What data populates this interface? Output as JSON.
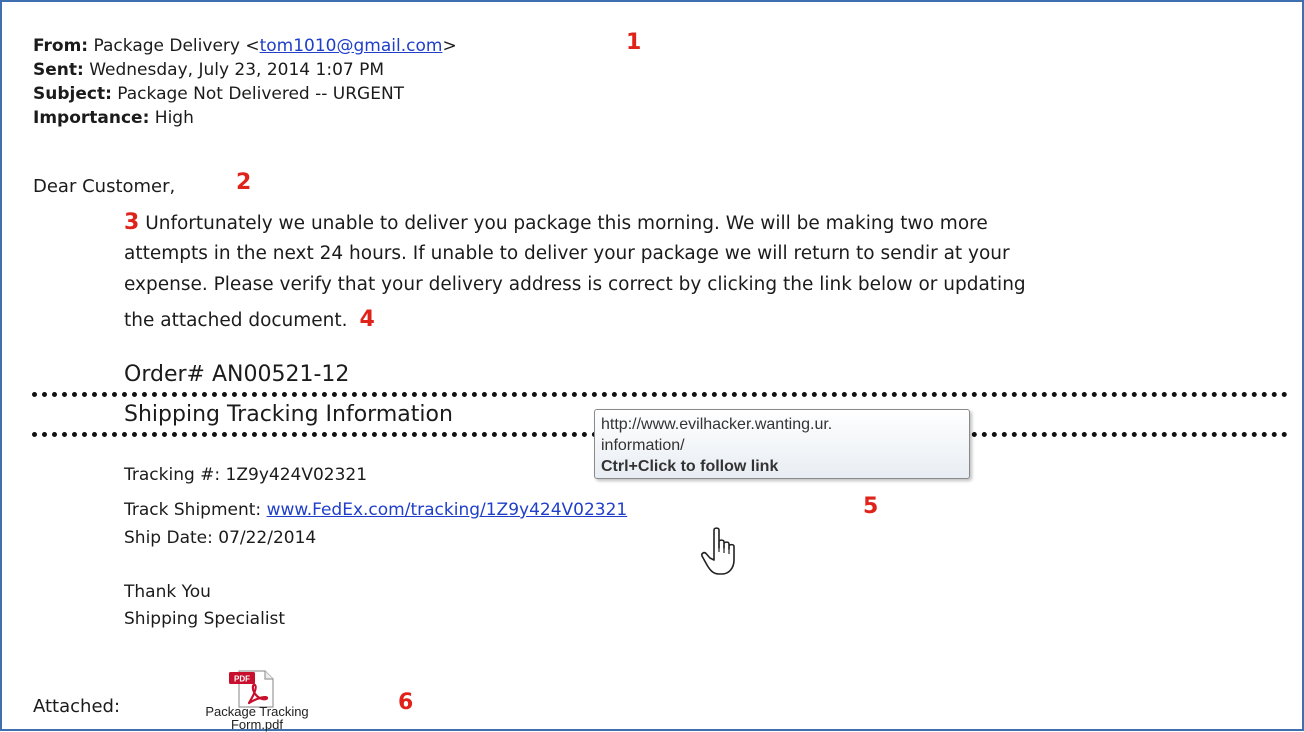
{
  "header": {
    "from_label": "From:",
    "from_name": "Package Delivery <",
    "from_email": "tom1010@gmail.com",
    "from_close": ">",
    "sent_label": "Sent:",
    "sent_value": "Wednesday, July 23, 2014 1:07 PM",
    "subject_label": "Subject:",
    "subject_value": "Package Not Delivered -- URGENT",
    "importance_label": "Importance:",
    "importance_value": "High"
  },
  "markers": [
    "1",
    "2",
    "3",
    "4",
    "5",
    "6"
  ],
  "body": {
    "greeting": "Dear Customer,",
    "paragraph_lines": [
      "Unfortunately we unable to deliver you package this morning. We will be making two more",
      "attempts in the next 24 hours. If unable to deliver your  package we will return to sendir at your",
      "expense. Please verify that your delivery address is correct by clicking the link below or updating",
      "the attached document."
    ],
    "order": "Order# AN00521-12",
    "section_title": "Shipping Tracking Information",
    "tracking_label": "Tracking #: 1Z9y424V02321",
    "track_shipment_label": "Track Shipment: ",
    "track_shipment_link": "www.FedEx.com/tracking/1Z9y424V02321",
    "ship_date": "Ship Date: 07/22/2014",
    "thanks": "Thank You",
    "signature": "Shipping Specialist"
  },
  "tooltip": {
    "url": "http://www.evilhacker.wanting.ur.\ninformation/",
    "hint": "Ctrl+Click to follow link"
  },
  "attachment": {
    "label": "Attached:",
    "icon_text": "PDF",
    "filename": "Package Tracking\nForm.pdf"
  },
  "colors": {
    "frame": "#3f6fae",
    "marker": "#e0231a",
    "link": "#1f3fc9",
    "pdf_red": "#c8102e"
  }
}
